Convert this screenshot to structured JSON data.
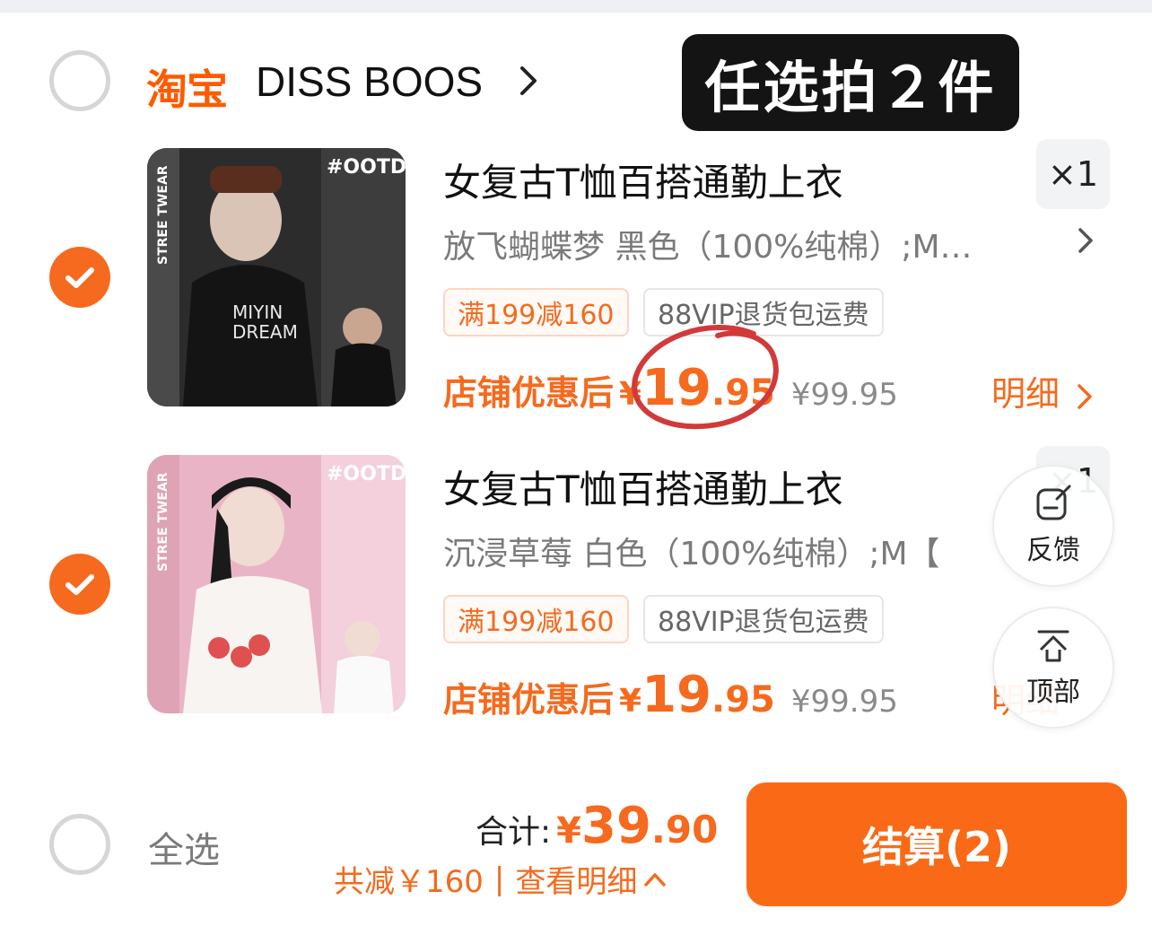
{
  "shop": {
    "logo_text": "淘宝",
    "name": "DISS BOOS",
    "promo_badge": "任选拍２件"
  },
  "items": [
    {
      "title": "女复古T恤百搭通勤上衣",
      "variant": "放飞蝴蝶梦 黑色（100%纯棉）;M…",
      "tags": [
        "满199减160",
        "88VIP退货包运费"
      ],
      "price_label": "店铺优惠后",
      "price_currency": "¥",
      "price_int": "19",
      "price_dec": ".95",
      "original_price": "¥99.95",
      "quantity": "×1",
      "detail_label": "明细",
      "checked": true,
      "thumb_tag": "#OOTD",
      "thumb_side": "STREE TWEAR",
      "thumb_color": "#3b3b3b"
    },
    {
      "title": "女复古T恤百搭通勤上衣",
      "variant": "沉浸草莓 白色（100%纯棉）;M【",
      "tags": [
        "满199减160",
        "88VIP退货包运费"
      ],
      "price_label": "店铺优惠后",
      "price_currency": "¥",
      "price_int": "19",
      "price_dec": ".95",
      "original_price": "¥99.95",
      "quantity": "×1",
      "detail_label": "明细",
      "checked": true,
      "thumb_tag": "#OOTD",
      "thumb_side": "STREE TWEAR",
      "thumb_color": "#e8b4c4"
    }
  ],
  "floating": {
    "feedback_label": "反馈",
    "top_label": "顶部"
  },
  "footer": {
    "select_all": "全选",
    "total_label": "合计:",
    "total_currency": "¥",
    "total_int": "39",
    "total_dec": ".90",
    "saving_text": "共减￥160",
    "view_detail": "查看明细",
    "checkout_label": "结算(2)"
  },
  "colors": {
    "accent": "#f56a1e",
    "checkout": "#fa6a16",
    "badge_bg": "#141414"
  }
}
